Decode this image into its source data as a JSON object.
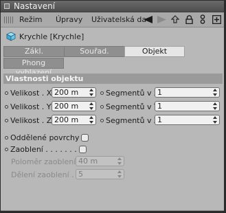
{
  "window": {
    "title": "Nastavení"
  },
  "menu": {
    "items": [
      "Režim",
      "Úpravy",
      "Uživatelská da"
    ]
  },
  "object": {
    "name": "Krychle [Krychle]"
  },
  "tabs": {
    "row1": [
      {
        "label": "Zákl.",
        "active": false
      },
      {
        "label": "Souřad.",
        "active": false
      },
      {
        "label": "Objekt",
        "active": true
      }
    ],
    "row2": [
      {
        "label": "Phong vyhlazení",
        "active": false
      }
    ]
  },
  "section": {
    "title": "Vlastnosti objektu"
  },
  "size": {
    "x_label": "Velikost . X",
    "y_label": "Velikost . Y",
    "z_label": "Velikost . Z",
    "x_value": "200 m",
    "y_value": "200 m",
    "z_value": "200 m"
  },
  "segments": {
    "x_label": "Segmentů v X",
    "y_label": "Segmentů v Y",
    "z_label": "Segmentů v Z",
    "x_value": "1",
    "y_value": "1",
    "z_value": "1"
  },
  "options": {
    "separate_surfaces_label": "Oddělené povrchy",
    "fillet_label": "Zaoblení . . . . . . .",
    "fillet_radius_label": "Poloměr zaoblení",
    "fillet_radius_value": "40 m",
    "fillet_subdivision_label": "Dělení zaoblení . .",
    "fillet_subdivision_value": "5"
  }
}
